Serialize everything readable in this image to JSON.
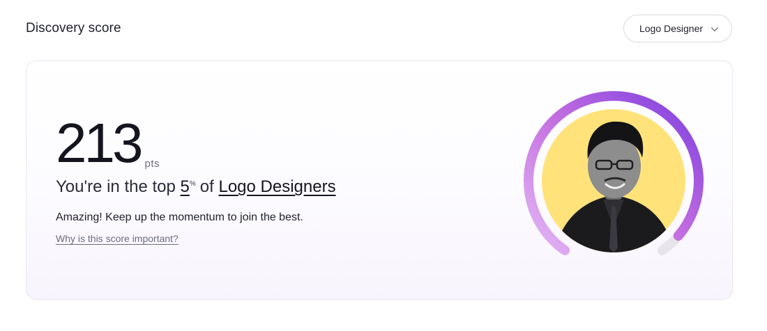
{
  "header": {
    "title": "Discovery score",
    "role_select_value": "Logo Designer"
  },
  "score": {
    "value": "213",
    "unit": "pts",
    "rank_prefix": "You're in the top",
    "rank_percent": "5",
    "rank_percent_symbol": "%",
    "rank_of": "of",
    "rank_group": "Logo Designers",
    "message": "Amazing! Keep up the momentum to join the best.",
    "why_link": "Why is this score important?"
  },
  "gauge": {
    "progress_fraction": 0.95,
    "colors": {
      "start": "#e3b8f5",
      "mid": "#c46ee0",
      "end": "#7c3fe0",
      "track": "#e7e5ec",
      "avatar_bg": "#ffe37a"
    }
  }
}
